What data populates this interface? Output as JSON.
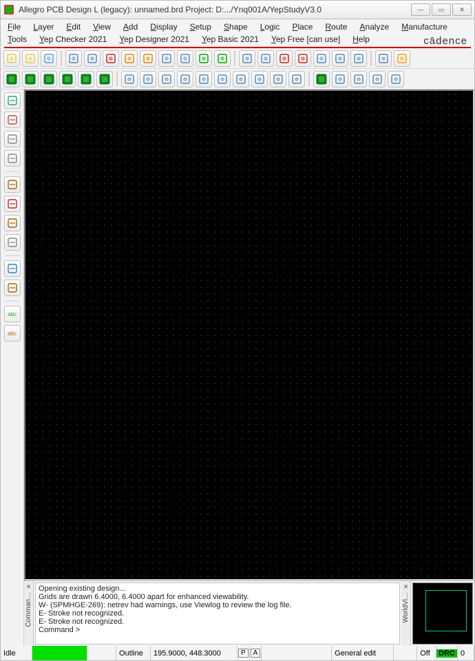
{
  "title": "Allegro PCB Design L (legacy): unnamed.brd  Project: D:.../Ynq001A/YepStudyV3.0",
  "menu": [
    {
      "label": "File",
      "u": "F"
    },
    {
      "label": "Layer",
      "u": "L"
    },
    {
      "label": "Edit",
      "u": "E"
    },
    {
      "label": "View",
      "u": "V"
    },
    {
      "label": "Add",
      "u": "A"
    },
    {
      "label": "Display",
      "u": "D"
    },
    {
      "label": "Setup",
      "u": "S"
    },
    {
      "label": "Shape",
      "u": "S"
    },
    {
      "label": "Logic",
      "u": "L"
    },
    {
      "label": "Place",
      "u": "P"
    },
    {
      "label": "Route",
      "u": "R"
    },
    {
      "label": "Analyze",
      "u": "A"
    },
    {
      "label": "Manufacture",
      "u": "M"
    }
  ],
  "menu2": [
    {
      "label": "Tools",
      "u": "T"
    },
    {
      "label": "Yep Checker 2021",
      "u": "Y"
    },
    {
      "label": "Yep Designer 2021",
      "u": "Y"
    },
    {
      "label": "Yep Basic 2021",
      "u": "Y"
    },
    {
      "label": "Yep Free [can use]",
      "u": "Y"
    },
    {
      "label": "Help",
      "u": "H"
    }
  ],
  "brand": "cādence",
  "toolbar1_icons": [
    "new",
    "open",
    "save",
    "|",
    "move",
    "copy",
    "delete",
    "undo",
    "redo",
    "sub1",
    "sub2",
    "check",
    "pin",
    "|",
    "zoom-full",
    "zoom-window",
    "zoom-in",
    "zoom-out",
    "zoom-prev",
    "zoom-sel",
    "zoom-center",
    "|",
    "refresh",
    "3d"
  ],
  "toolbar2_icons": [
    "g1",
    "g2",
    "g3",
    "g4",
    "g5",
    "g6",
    "|",
    "sh-rect",
    "sh-poly",
    "sh-circ",
    "sh-sel",
    "sh-a",
    "sh-b",
    "sh-c",
    "sh-d",
    "sh-e",
    "sh-f",
    "|",
    "grp",
    "db",
    "meas1",
    "meas2",
    "odb"
  ],
  "side_icons": [
    {
      "n": "find",
      "c": "#2a7"
    },
    {
      "n": "layers",
      "c": "#c44"
    },
    {
      "n": "net",
      "c": "#888"
    },
    {
      "n": "nets2",
      "c": "#888"
    },
    {
      "n": "-"
    },
    {
      "n": "p1",
      "c": "#a60"
    },
    {
      "n": "p2",
      "c": "#c22"
    },
    {
      "n": "p3",
      "c": "#a60"
    },
    {
      "n": "p4",
      "c": "#888"
    },
    {
      "n": "-"
    },
    {
      "n": "t1",
      "c": "#28c"
    },
    {
      "n": "t2",
      "c": "#a60"
    },
    {
      "n": "-"
    },
    {
      "n": "abc1",
      "c": "#2a2",
      "t": "abc"
    },
    {
      "n": "abc2",
      "c": "#a60",
      "t": "abc"
    }
  ],
  "console": {
    "lines": [
      "Opening existing design...",
      "Grids are drawn 6.4000, 6.4000 apart for enhanced viewability.",
      "W- (SPMHGE-269): netrev had warnings, use Viewlog to review the log file.",
      "E- Stroke not recognized.",
      "E- Stroke not recognized.",
      "Command >"
    ],
    "label": "Comman…",
    "wv_label": "WorldVi…"
  },
  "status": {
    "idle": "Idle",
    "outline": "Outline",
    "coords": "195.9000, 448.3000",
    "p": "P",
    "a": "A",
    "mode": "General edit",
    "off": "Off",
    "drc": "DRC",
    "count": "0"
  }
}
